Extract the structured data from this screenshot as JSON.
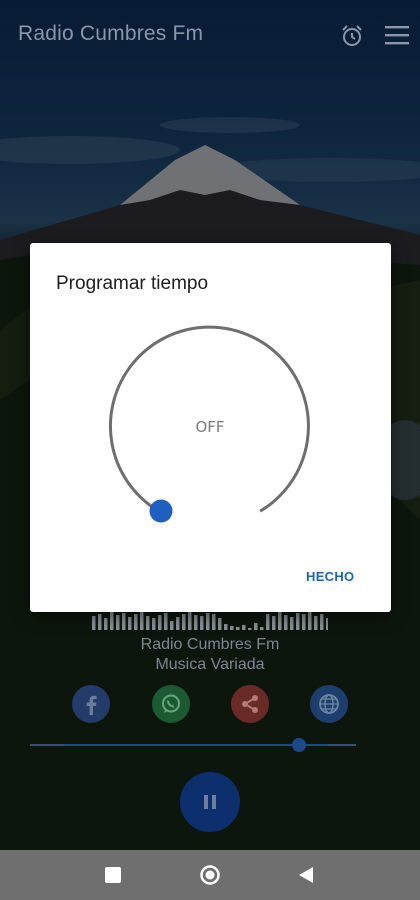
{
  "app": {
    "title": "Radio Cumbres Fm",
    "alarm_icon": "alarm-clock-icon",
    "menu_icon": "hamburger-menu-icon"
  },
  "player": {
    "station_name": "Radio Cumbres Fm",
    "station_genre": "Musica Variada",
    "social": [
      {
        "icon": "facebook-icon",
        "color": "#3b5998"
      },
      {
        "icon": "whatsapp-icon",
        "color": "#25d366"
      },
      {
        "icon": "share-icon",
        "color": "#e74c3c"
      },
      {
        "icon": "globe-icon",
        "color": "#2c6fb5"
      }
    ],
    "volume_fraction": 0.8,
    "play_state_icon": "pause-icon"
  },
  "dialog": {
    "title": "Programar tiempo",
    "dial_value": "OFF",
    "done_label": "HECHO",
    "accent": "#1f5fbf"
  },
  "navbar": {
    "icons": [
      "recents-square-icon",
      "home-circle-icon",
      "back-triangle-icon"
    ]
  }
}
